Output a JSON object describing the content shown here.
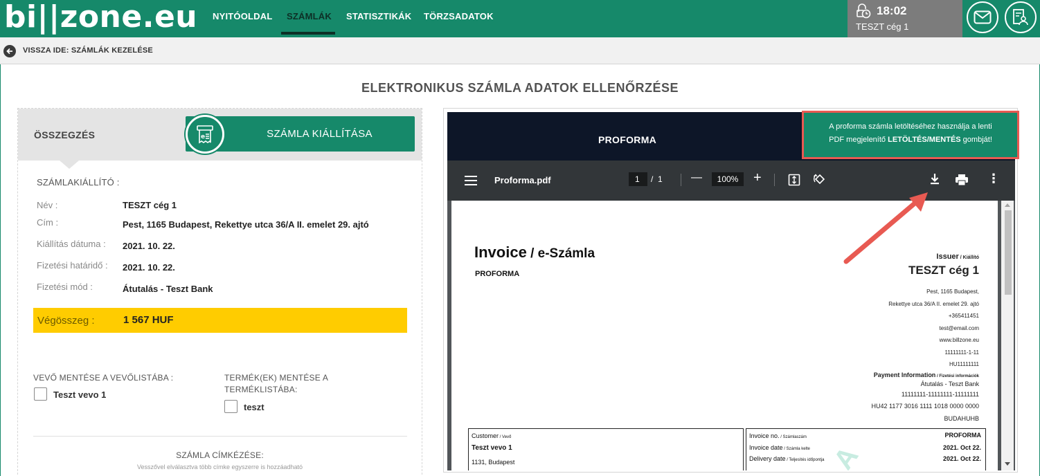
{
  "header": {
    "logo": "bi||zone.eu",
    "nav": [
      {
        "label": "NYITÓOLDAL"
      },
      {
        "label": "SZÁMLÁK",
        "active": true
      },
      {
        "label": "STATISZTIKÁK"
      },
      {
        "label": "TÖRZSADATOK"
      }
    ],
    "user": {
      "time": "18:02",
      "company": "TESZT cég 1"
    },
    "icons": [
      "clock-icon",
      "mail-icon",
      "user-settings-icon"
    ]
  },
  "breadcrumb": {
    "label": "VISSZA IDE: SZÁMLÁK KEZELÉSE"
  },
  "page_title": "ELEKTRONIKUS SZÁMLA ADATOK ELLENŐRZÉSE",
  "summary": {
    "title": "ÖSSZEGZÉS",
    "issue_button": "SZÁMLA KIÁLLÍTÁSA",
    "issuer_section": "SZÁMLAKIÁLLÍTÓ :",
    "fields": [
      {
        "label": "Név :",
        "value": "TESZT cég 1"
      },
      {
        "label": "Cím :",
        "value": "Pest, 1165 Budapest, Rekettye utca 36/A II. emelet 29. ajtó"
      },
      {
        "label": "Kiállítás dátuma :",
        "value": "2021. 10. 22."
      },
      {
        "label": "Fizetési határidő :",
        "value": "2021. 10. 22."
      },
      {
        "label": "Fizetési mód :",
        "value": "Átutalás - Teszt Bank"
      }
    ],
    "total": {
      "label": "Végösszeg :",
      "value": "1 567 HUF"
    },
    "save_buyer": {
      "title": "VEVŐ MENTÉSE A VEVŐLISTÁBA :",
      "item": "Teszt vevo 1"
    },
    "save_product": {
      "title_line1": "TERMÉK(EK) MENTÉSE A",
      "title_line2": "TERMÉKLISTÁBA:",
      "item": "teszt"
    },
    "tags": {
      "title": "SZÁMLA CÍMKÉZÉSE:",
      "hint": "Vesszővel elválasztva több címke egyszerre is hozzáadható"
    }
  },
  "preview": {
    "title": "PROFORMA",
    "tip_line1": "A proforma számla letöltéséhez használja a lenti",
    "tip_line2_pre": "PDF megjelenítő ",
    "tip_line2_bold": "LETÖLTÉS/MENTÉS",
    "tip_line2_post": " gombját!",
    "pdf": {
      "filename": "Proforma.pdf",
      "page": "1",
      "page_sep": "/",
      "pages": "1",
      "zoom": "100%",
      "minus": "—",
      "plus": "+",
      "more": "⋮"
    },
    "invoice": {
      "title_main": "Invoice",
      "title_sep": " / ",
      "title_hu": "e-Számla",
      "type": "PROFORMA",
      "issuer_head": "Issuer",
      "issuer_head_hu": " / Kiállító",
      "issuer_name": "TESZT cég 1",
      "issuer_lines": [
        "Pest, 1165 Budapest,",
        "Rekettye utca 36/A II. emelet 29. ajtó",
        "+365411451",
        "test@email.com",
        "www.billzone.eu",
        "11111111-1-11",
        "HU11111111"
      ],
      "payment_head": "Payment Information",
      "payment_head_hu": " / Fizetési információk",
      "payment_lines": [
        "Átutalás - Teszt Bank",
        "11111111-11111111-11111111",
        "HU42 1177 3016 1111 1018 0000 0000",
        "BUDAHUHB"
      ],
      "customer_label": "Customer",
      "customer_label_hu": " / Vevő",
      "customer_name": "Teszt vevo 1",
      "customer_addr": "1131, Budapest",
      "inv_no_label": "Invoice no.",
      "inv_no_label_hu": " / Számlaszám",
      "inv_no_value": "PROFORMA",
      "inv_date_label": "Invoice date",
      "inv_date_label_hu": " / Számla kelte",
      "inv_date_value": "2021. Oct 22.",
      "deliv_label": "Delivery date",
      "deliv_label_hu": " / Teljesítés időpontja",
      "deliv_value": "2021. Oct 22.",
      "watermark": "A"
    }
  },
  "colors": {
    "brand": "#16896a",
    "highlight": "#ffcc00",
    "callout": "#e85a52"
  }
}
